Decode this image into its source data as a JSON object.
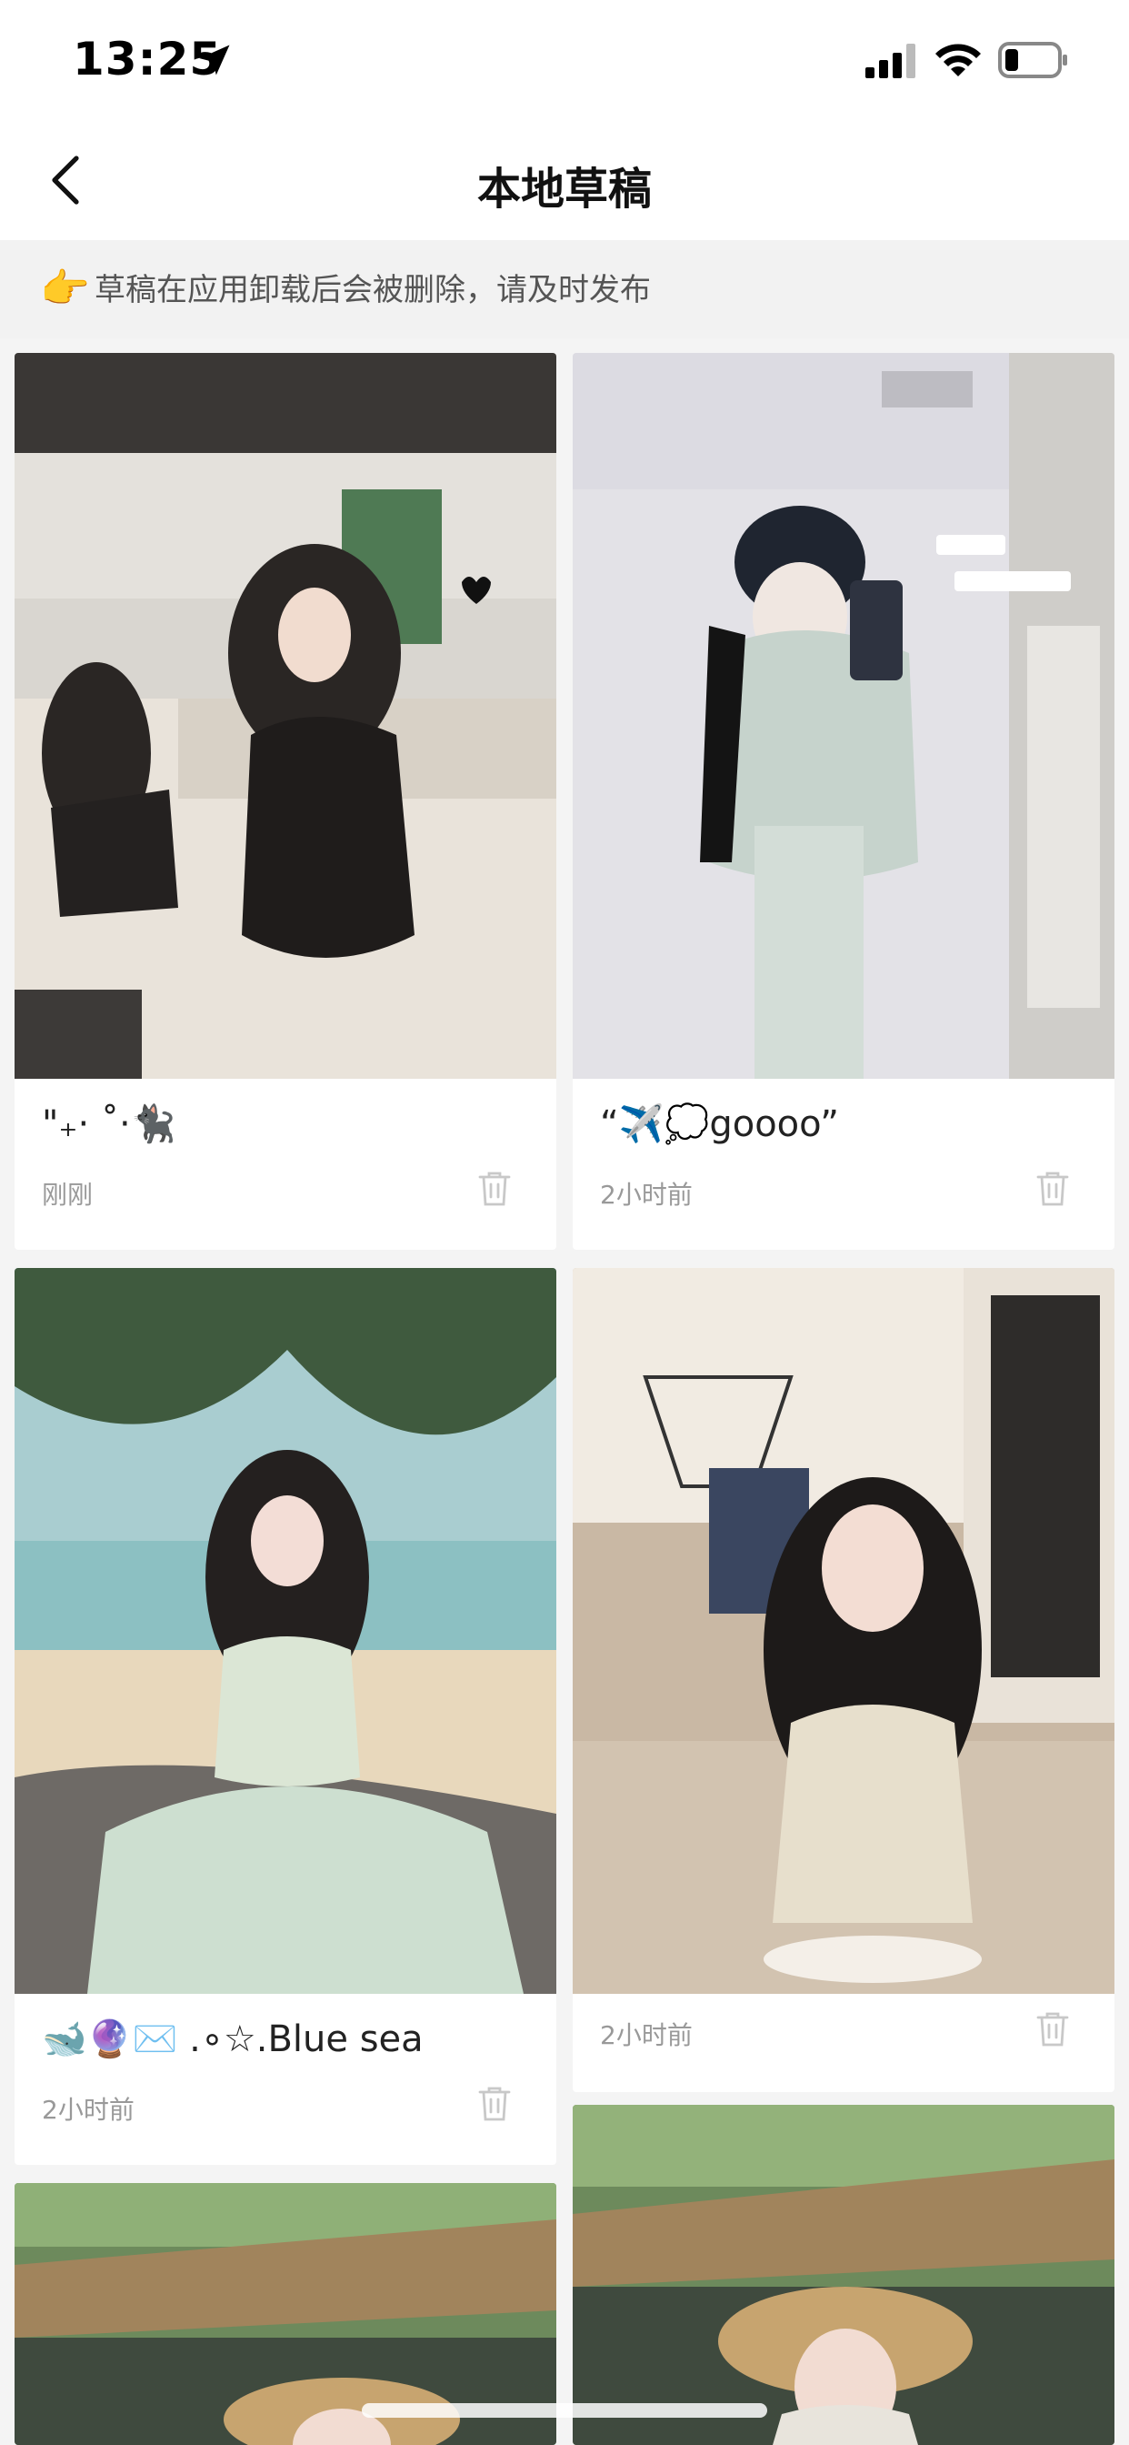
{
  "status_bar": {
    "time": "13:25",
    "icons": [
      "location-arrow-icon",
      "cellular-signal-icon",
      "wifi-icon",
      "battery-icon"
    ]
  },
  "nav": {
    "title": "本地草稿",
    "back_icon": "chevron-left-icon"
  },
  "notice": {
    "icon": "👉",
    "text": "草稿在应用卸载后会被删除，请及时发布"
  },
  "drafts": [
    {
      "title": "\"₊· ˚·🐈‍⬛",
      "time": "刚刚",
      "image": "girl in black dress sitting on sofa"
    },
    {
      "title": "“✈️💭goooo”",
      "time": "2小时前",
      "image": "girl taking mirror selfie in cap"
    },
    {
      "title": "🐋🔮✉️ .∘☆.Blue sea",
      "time": "2小时前",
      "image": "girl in mint dress at beach"
    },
    {
      "title": "",
      "time": "2小时前",
      "image": "girl holding wine glass in restaurant"
    },
    {
      "title": "",
      "time": "",
      "image": "girl with straw hat under thatched roof"
    },
    {
      "title": "",
      "time": "",
      "image": "girl with straw hat under thatched roof"
    }
  ],
  "colors": {
    "background": "#f4f4f4",
    "card": "#ffffff",
    "muted_text": "#999999"
  }
}
